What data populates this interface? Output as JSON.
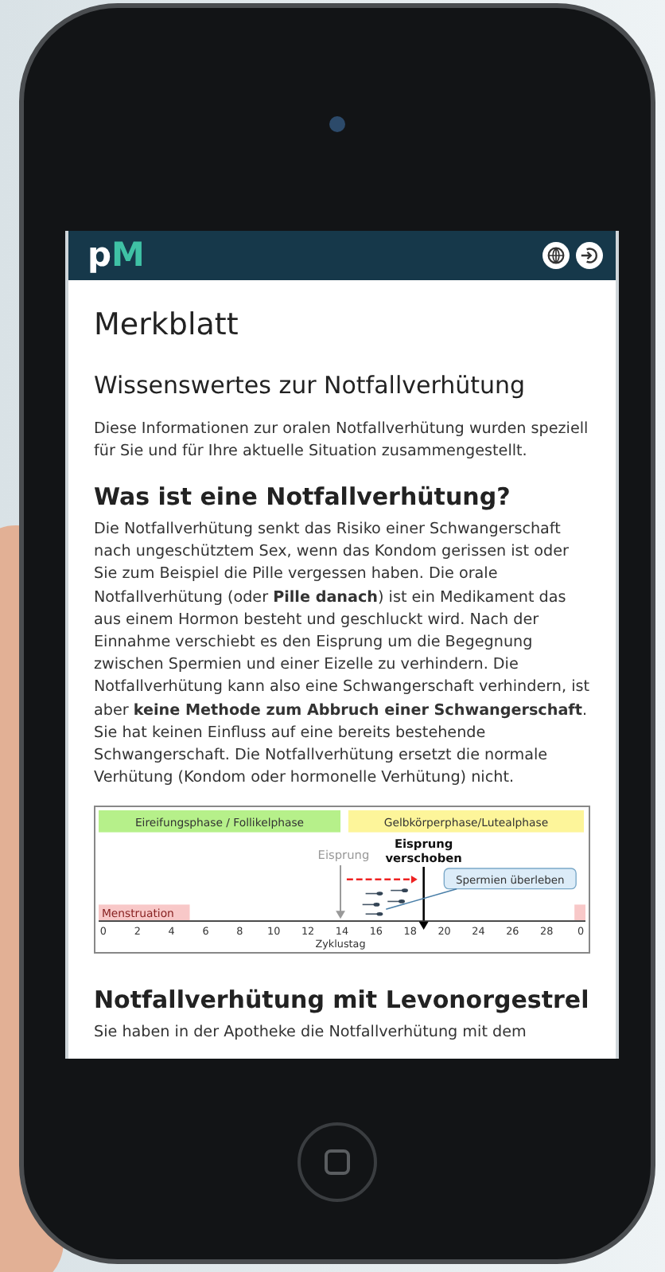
{
  "header": {
    "logo_parts": [
      "p",
      "M"
    ]
  },
  "page_title": "Merkblatt",
  "sections": [
    {
      "heading": "Wissenswertes zur Notfallverhütung",
      "kind": "subtitle",
      "text": "Diese Informationen zur oralen Notfallverhütung wurden speziell für Sie und für Ihre aktuelle Situation zusammengestellt."
    },
    {
      "heading": "Was ist eine Notfallverhütung?",
      "kind": "heading",
      "text": "Die Notfallverhütung senkt das Risiko einer Schwangerschaft nach ungeschütztem Sex, wenn das Kondom gerissen ist oder Sie zum Beispiel die Pille vergessen haben. Die orale Notfallverhütung (oder **Pille danach**) ist ein Medikament das aus einem Hormon besteht und geschluckt wird. Nach der Einnahme verschiebt es den Eisprung um die Begegnung zwischen Spermien und einer Eizelle zu verhindern. Die Notfallverhütung kann also eine Schwangerschaft verhindern, ist aber **keine Methode zum Abbruch einer Schwangerschaft**. Sie hat keinen Einfluss auf eine bereits bestehende Schwangerschaft. Die Notfallverhütung ersetzt die normale Verhütung (Kondom oder hormonelle Verhütung) nicht.",
      "figure": {
        "phases": [
          {
            "label": "Eireifungsphase / Follikelphase",
            "color": "#b6f08a"
          },
          {
            "label": "Gelbkörperphase/Lutealphase",
            "color": "#fdf59a"
          }
        ],
        "ovulation": "Eisprung",
        "shifted": [
          "Eisprung",
          "verschoben"
        ],
        "callout": "Spermien überleben",
        "menstruation": "Menstruation",
        "ticks": [
          "0",
          "2",
          "4",
          "6",
          "8",
          "10",
          "12",
          "14",
          "16",
          "18",
          "20",
          "24",
          "26",
          "28",
          "0"
        ],
        "axis_label": "Zyklustag"
      }
    },
    {
      "heading": "Notfallverhütung mit Levonorgestrel",
      "kind": "heading",
      "text": "Sie haben in der Apotheke die Notfallverhütung mit dem"
    }
  ]
}
